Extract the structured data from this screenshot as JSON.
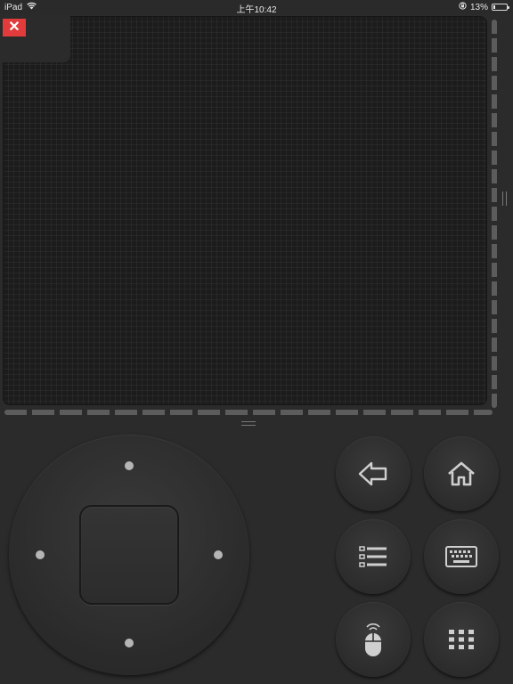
{
  "status_bar": {
    "device": "iPad",
    "time": "上午10:42",
    "battery_text": "13%",
    "battery_level": 0.13,
    "icons": [
      "wifi-icon",
      "rotation-lock-icon",
      "battery-icon"
    ]
  },
  "close_button": {
    "glyph": "✕",
    "icon": "close-icon",
    "color": "#e23b3b"
  },
  "trackpad": {
    "background": "#1c1c1c"
  },
  "dpad": {
    "directions": [
      "up",
      "down",
      "left",
      "right"
    ],
    "center": "select"
  },
  "buttons": [
    {
      "name": "back",
      "icon": "back-arrow-icon"
    },
    {
      "name": "home",
      "icon": "home-icon"
    },
    {
      "name": "menu",
      "icon": "list-menu-icon"
    },
    {
      "name": "keyboard",
      "icon": "keyboard-icon"
    },
    {
      "name": "mouse",
      "icon": "mouse-icon"
    },
    {
      "name": "apps",
      "icon": "apps-grid-icon"
    }
  ],
  "colors": {
    "background": "#2b2b2b",
    "accent_red": "#e23b3b",
    "icon": "#cfcfcf"
  }
}
